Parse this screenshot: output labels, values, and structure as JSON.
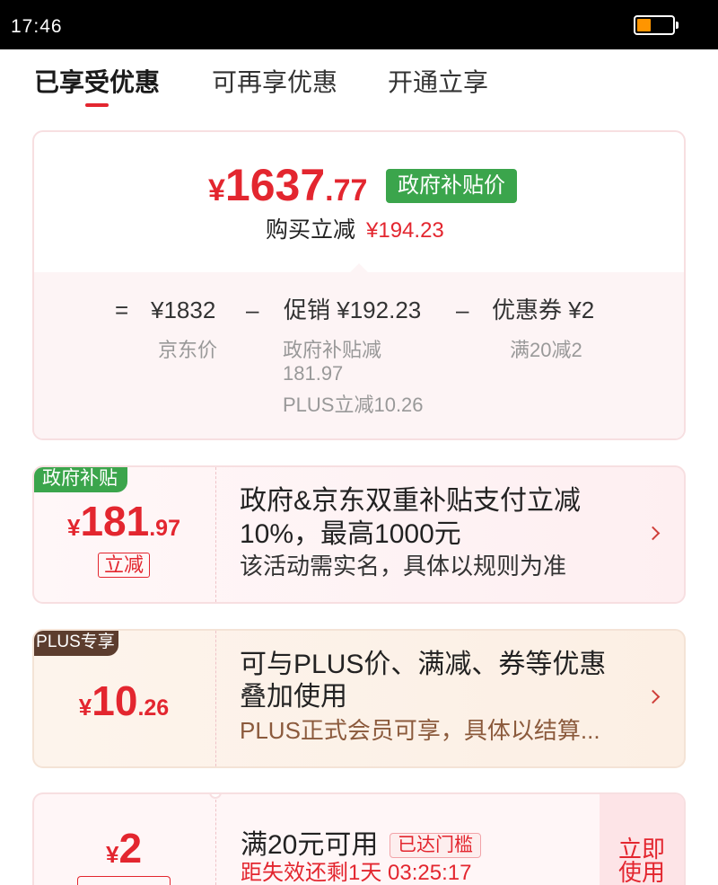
{
  "status_bar": {
    "time": "17:46",
    "battery_level_percent": 40,
    "battery_color": "#ff9500"
  },
  "tabs": [
    {
      "label": "已享受优惠",
      "active": true
    },
    {
      "label": "可再享优惠",
      "active": false
    },
    {
      "label": "开通立享",
      "active": false
    }
  ],
  "colors": {
    "price_red": "#e3262f",
    "subsidy_green": "#3ba54c",
    "plus_brown": "#5c3d2e"
  },
  "summary": {
    "final_price": {
      "symbol": "¥",
      "integer": "1637",
      "decimal": ".77"
    },
    "price_tag": "政府补贴价",
    "saving_label": "购买立减",
    "saving_value": "¥194.23",
    "breakdown": {
      "equals": "=",
      "minus": "–",
      "jd_price": {
        "value": "¥1832",
        "note": "京东价"
      },
      "promotion": {
        "label": "促销",
        "value": "¥192.23",
        "notes": [
          "政府补贴减",
          "181.97",
          "PLUS立减10.26"
        ]
      },
      "coupon": {
        "label": "优惠券",
        "value": "¥2",
        "note": "满20减2"
      }
    }
  },
  "offers": [
    {
      "tag": "政府补贴",
      "amount": {
        "symbol": "¥",
        "integer": "181",
        "decimal": ".97"
      },
      "amount_label": "立减",
      "title_lines": [
        "政府&京东双重补贴支付立减",
        "10%，最高1000元"
      ],
      "description": "该活动需实名，具体以规则为准",
      "icon": "chevron-right-icon"
    },
    {
      "tag": "PLUS专享",
      "amount": {
        "symbol": "¥",
        "integer": "10",
        "decimal": ".26"
      },
      "title_lines": [
        "可与PLUS价、满减、券等优惠",
        "叠加使用"
      ],
      "description": "PLUS正式会员可享，具体以结算...",
      "icon": "chevron-right-icon"
    },
    {
      "amount": {
        "symbol": "¥",
        "integer": "2"
      },
      "title": "满20元可用",
      "status_badge": "已达门槛",
      "countdown": "距失效还剩1天 03:25:17",
      "action_lines": [
        "立即",
        "使用"
      ]
    }
  ]
}
